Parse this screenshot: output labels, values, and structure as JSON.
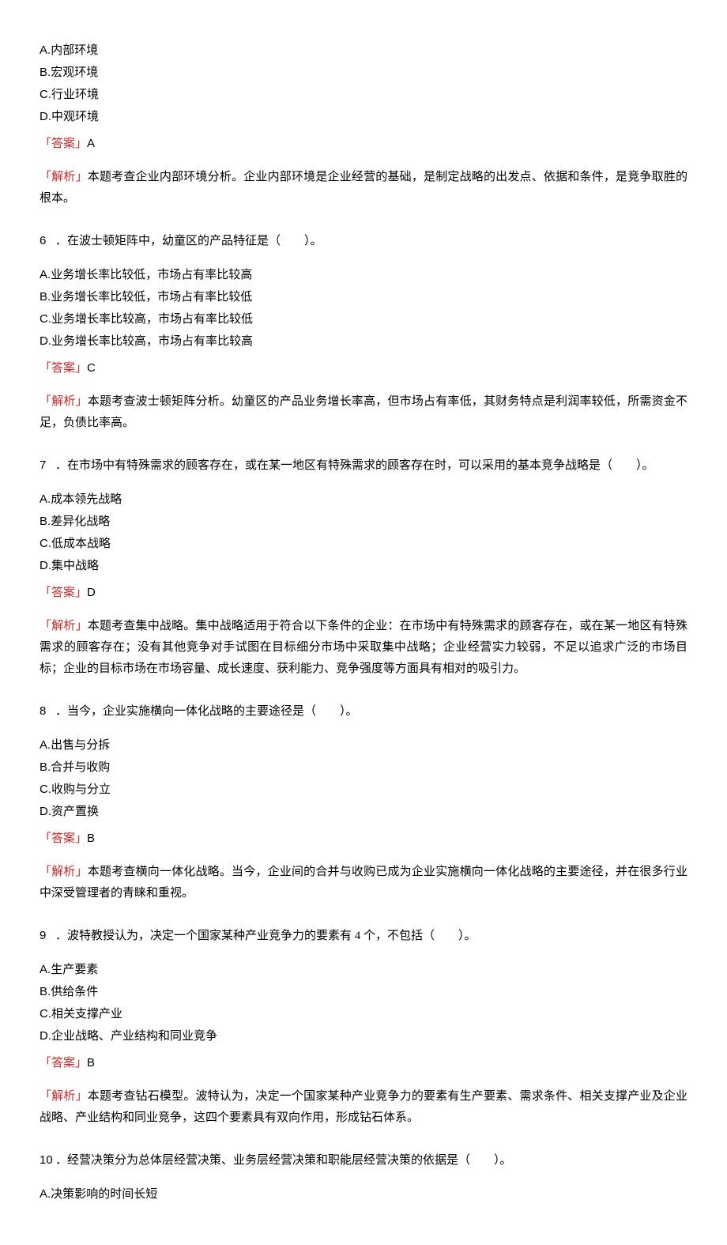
{
  "labels": {
    "answer_label": "「答案」",
    "explain_label": "「解析」"
  },
  "q5_tail": {
    "options": {
      "A": "内部环境",
      "B": "宏观环境",
      "C": "行业环境",
      "D": "中观环境"
    },
    "answer": "A",
    "explain": "本题考查企业内部环境分析。企业内部环境是企业经营的基础，是制定战略的出发点、依据和条件，是竞争取胜的根本。"
  },
  "q6": {
    "num": "6",
    "stem": "．在波士顿矩阵中，幼童区的产品特征是（　　）。",
    "options": {
      "A": "业务增长率比较低，市场占有率比较高",
      "B": "业务增长率比较低，市场占有率比较低",
      "C": "业务增长率比较高，市场占有率比较低",
      "D": "业务增长率比较高，市场占有率比较高"
    },
    "answer": "C",
    "explain": "本题考查波士顿矩阵分析。幼童区的产品业务增长率高，但市场占有率低，其财务特点是利润率较低，所需资金不足，负债比率高。"
  },
  "q7": {
    "num": "7",
    "stem": "．在市场中有特殊需求的顾客存在，或在某一地区有特殊需求的顾客存在时，可以采用的基本竞争战略是（　　）。",
    "options": {
      "A": "成本领先战略",
      "B": "差异化战略",
      "C": "低成本战略",
      "D": "集中战略"
    },
    "answer": "D",
    "explain": "本题考查集中战略。集中战略适用于符合以下条件的企业：在市场中有特殊需求的顾客存在，或在某一地区有特殊需求的顾客存在；没有其他竞争对手试图在目标细分市场中采取集中战略；企业经营实力较弱，不足以追求广泛的市场目标；企业的目标市场在市场容量、成长速度、获利能力、竞争强度等方面具有相对的吸引力。"
  },
  "q8": {
    "num": "8",
    "stem": "．当今，企业实施横向一体化战略的主要途径是（　　）。",
    "options": {
      "A": "出售与分拆",
      "B": "合并与收购",
      "C": "收购与分立",
      "D": "资产置换"
    },
    "answer": "B",
    "explain": "本题考查横向一体化战略。当今，企业间的合并与收购已成为企业实施横向一体化战略的主要途径，并在很多行业中深受管理者的青睐和重视。"
  },
  "q9": {
    "num": "9",
    "stem": "．波特教授认为，决定一个国家某种产业竞争力的要素有 4 个，不包括（　　）。",
    "options": {
      "A": "生产要素",
      "B": "供给条件",
      "C": "相关支撑产业",
      "D": "企业战略、产业结构和同业竞争"
    },
    "answer": "B",
    "explain": "本题考查钻石模型。波特认为，决定一个国家某种产业竞争力的要素有生产要素、需求条件、相关支撑产业及企业战略、产业结构和同业竞争，这四个要素具有双向作用，形成钻石体系。"
  },
  "q10_head": {
    "num": "10",
    "stem": "．经营决策分为总体层经营决策、业务层经营决策和职能层经营决策的依据是（　　）。",
    "optionA": "决策影响的时间长短"
  }
}
